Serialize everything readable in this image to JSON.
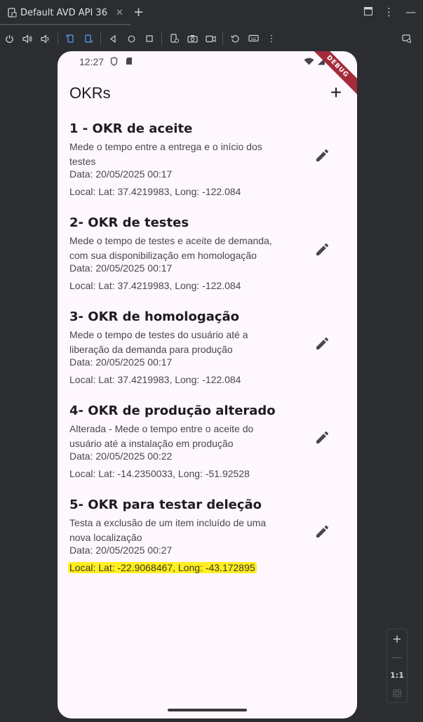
{
  "window": {
    "tab_title": "Default AVD API 36",
    "tab_close": "✕",
    "new_tab": "+"
  },
  "toolbar": {
    "icons": [
      "power-icon",
      "volume-up-icon",
      "volume-down-icon",
      "rotate-left-icon",
      "rotate-right-icon",
      "back-icon",
      "home-icon",
      "overview-icon",
      "fold-icon",
      "camera-icon",
      "record-icon",
      "reset-icon",
      "keyboard-icon",
      "more-icon"
    ]
  },
  "phone": {
    "status": {
      "time": "12:27"
    },
    "debug_banner": "DEBUG",
    "app_title": "OKRs",
    "add_label": "+",
    "okrs": [
      {
        "title": "1 - OKR de aceite",
        "description": "Mede o tempo entre a entrega e o início dos testes",
        "date": "Data: 20/05/2025 00:17",
        "location": "Local: Lat: 37.4219983, Long: -122.084"
      },
      {
        "title": "2- OKR de testes",
        "description": "Mede o tempo de testes e aceite de demanda, com sua disponibilização em homologação",
        "date": "Data: 20/05/2025 00:17",
        "location": "Local: Lat: 37.4219983, Long: -122.084"
      },
      {
        "title": "3- OKR de homologação",
        "description": "Mede o tempo de testes do usuário até a liberação da demanda para produção",
        "date": "Data: 20/05/2025 00:17",
        "location": "Local: Lat: 37.4219983, Long: -122.084"
      },
      {
        "title": "4- OKR de produção alterado",
        "description": "Alterada - Mede o tempo entre o aceite do usuário até a instalação em produção",
        "date": "Data: 20/05/2025 00:22",
        "location": "Local: Lat: -14.2350033, Long: -51.92528"
      },
      {
        "title": "5- OKR para testar deleção",
        "description": "Testa a exclusão de um item incluído de uma nova localização",
        "date": "Data: 20/05/2025 00:27",
        "location": "Local: Lat: -22.9068467, Long: -43.172895"
      }
    ]
  },
  "zoom": {
    "plus": "+",
    "minus": "—",
    "one_to_one": "1:1"
  },
  "colors": {
    "highlight": "#ffee21",
    "app_background": "#fef7fe",
    "ide_background": "#2b2d30",
    "debug_banner": "#a52a3a"
  }
}
